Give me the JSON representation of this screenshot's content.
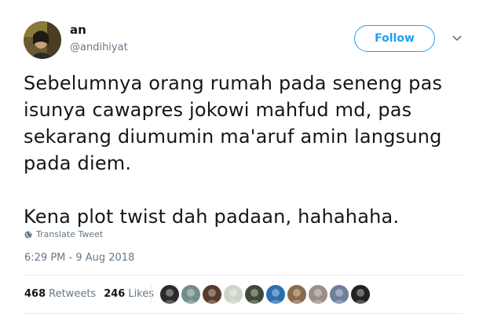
{
  "user": {
    "display_name": "an",
    "handle": "@andihiyat"
  },
  "follow_label": "Follow",
  "tweet_lines": [
    "Sebelumnya orang rumah pada seneng pas",
    "isunya cawapres jokowi mahfud md, pas",
    "sekarang diumumin ma'aruf amin langsung",
    "pada diem.",
    "",
    "Kena plot twist dah padaan, hahahaha."
  ],
  "translate_label": "Translate Tweet",
  "timestamp": "6:29 PM - 9 Aug 2018",
  "stats": {
    "retweets_count": "468",
    "retweets_label": "Retweets",
    "likes_count": "246",
    "likes_label": "Likes"
  },
  "colors": {
    "accent": "#1da1f2",
    "secondary_text": "#657786",
    "primary_text": "#14171a",
    "divider": "#e6ecf0"
  },
  "icons": {
    "chevron": "chevron-down-icon",
    "globe": "globe-icon"
  },
  "likers": [
    {
      "color": "#2b2b2b"
    },
    {
      "color": "#6f8f8a"
    },
    {
      "color": "#5a3a2a"
    },
    {
      "color": "#cfd4c8"
    },
    {
      "color": "#3f4a3a"
    },
    {
      "color": "#2c6fb0"
    },
    {
      "color": "#8b6a4c"
    },
    {
      "color": "#9a8f86"
    },
    {
      "color": "#6d7f9b"
    },
    {
      "color": "#222222"
    }
  ]
}
